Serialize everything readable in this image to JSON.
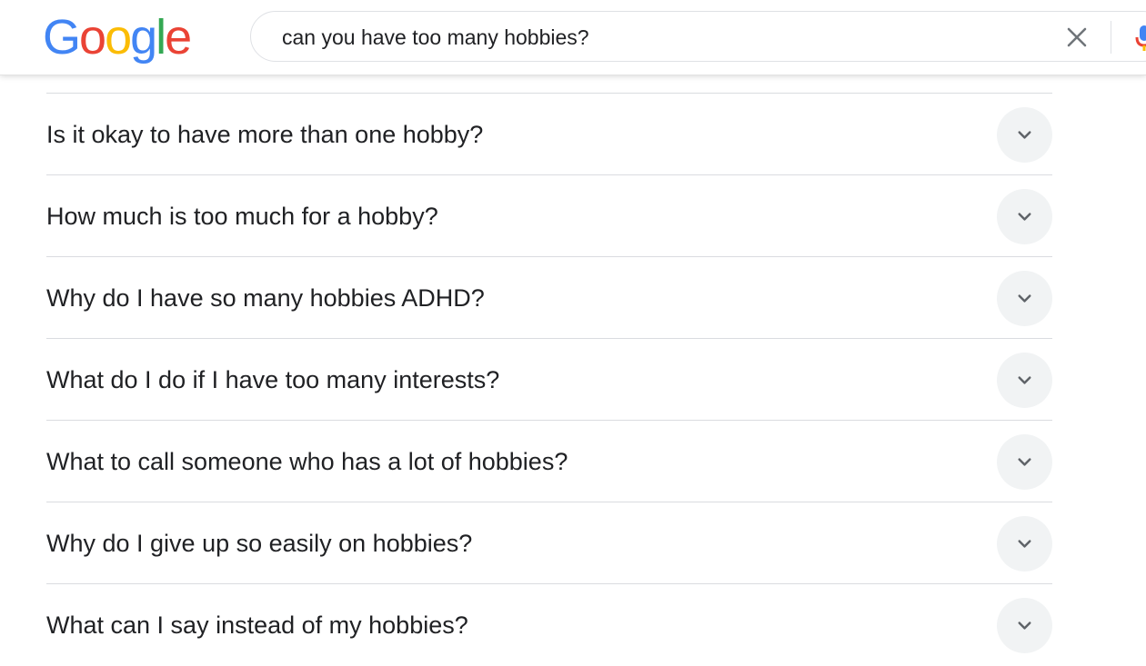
{
  "header": {
    "logo": {
      "letters": [
        "G",
        "o",
        "o",
        "g",
        "l",
        "e"
      ],
      "colors": [
        "#4285F4",
        "#EA4335",
        "#FBBC05",
        "#4285F4",
        "#34A853",
        "#EA4335"
      ]
    },
    "search": {
      "value": "can you have too many hobbies?"
    },
    "icons": {
      "clear": "close-icon",
      "mic": "microphone-icon"
    }
  },
  "related_questions": {
    "items": [
      {
        "question": "Is it okay to have more than one hobby?"
      },
      {
        "question": "How much is too much for a hobby?"
      },
      {
        "question": "Why do I have so many hobbies ADHD?"
      },
      {
        "question": "What do I do if I have too many interests?"
      },
      {
        "question": "What to call someone who has a lot of hobbies?"
      },
      {
        "question": "Why do I give up so easily on hobbies?"
      },
      {
        "question": "What can I say instead of my hobbies?"
      }
    ],
    "expand_icon": "chevron-down-icon"
  },
  "colors": {
    "text": "#202124",
    "divider": "#dadce0",
    "chevron_bg": "#f1f3f4",
    "chevron": "#5f6368"
  }
}
